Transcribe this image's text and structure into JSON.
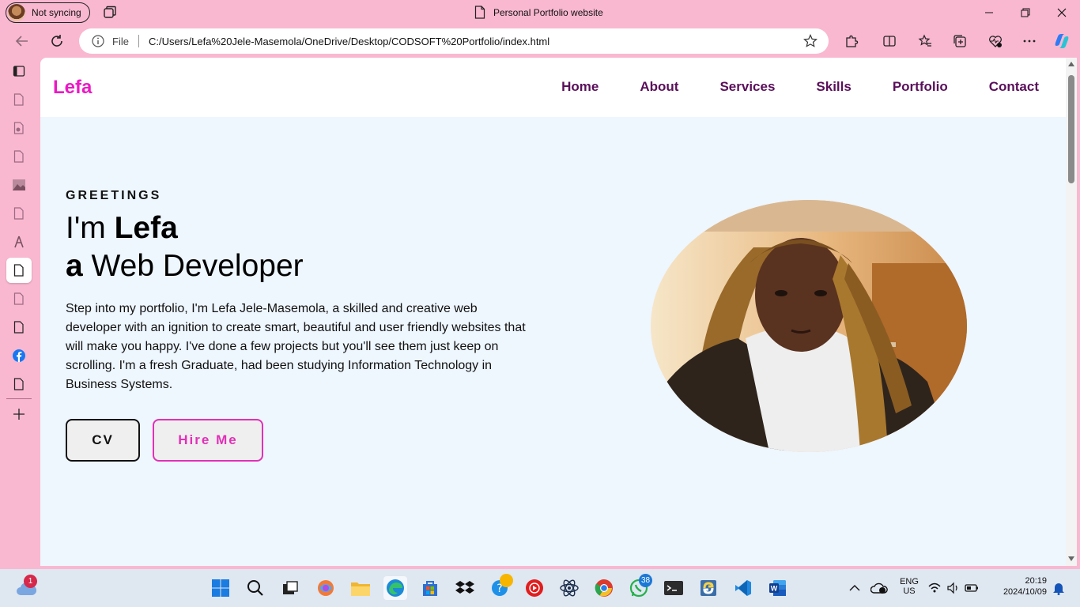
{
  "browser": {
    "profile_label": "Not syncing",
    "tab_title": "Personal Portfolio website",
    "scheme_label": "File",
    "url": "C:/Users/Lefa%20Jele-Masemola/OneDrive/Desktop/CODSOFT%20Portfolio/index.html"
  },
  "site": {
    "logo": "Lefa",
    "nav": [
      "Home",
      "About",
      "Services",
      "Skills",
      "Portfolio",
      "Contact"
    ],
    "hero": {
      "greeting": "GREETINGS",
      "line1_prefix": "I'm ",
      "line1_name": "Lefa",
      "line2_prefix": "a",
      "line2_role": " Web Developer",
      "description": "Step into my portfolio, I'm Lefa Jele-Masemola, a skilled and creative web developer with an ignition to create smart, beautiful and user friendly websites that will make you happy. I've done a few projects but you'll see them just keep on scrolling. I'm a fresh Graduate, had been studying Information Technology in Business Systems.",
      "cv_button": "CV",
      "hire_button": "Hire Me"
    }
  },
  "taskbar": {
    "weather_badge": "1",
    "whatsapp_badge": "38",
    "language_line1": "ENG",
    "language_line2": "US",
    "time": "20:19",
    "date": "2024/10/09"
  },
  "colors": {
    "chrome_pink": "#f9b8d0",
    "logo_magenta": "#ec18c6",
    "nav_purple": "#5a0f5a",
    "hire_pink": "#e230b7",
    "page_bg": "#eef6fe"
  }
}
